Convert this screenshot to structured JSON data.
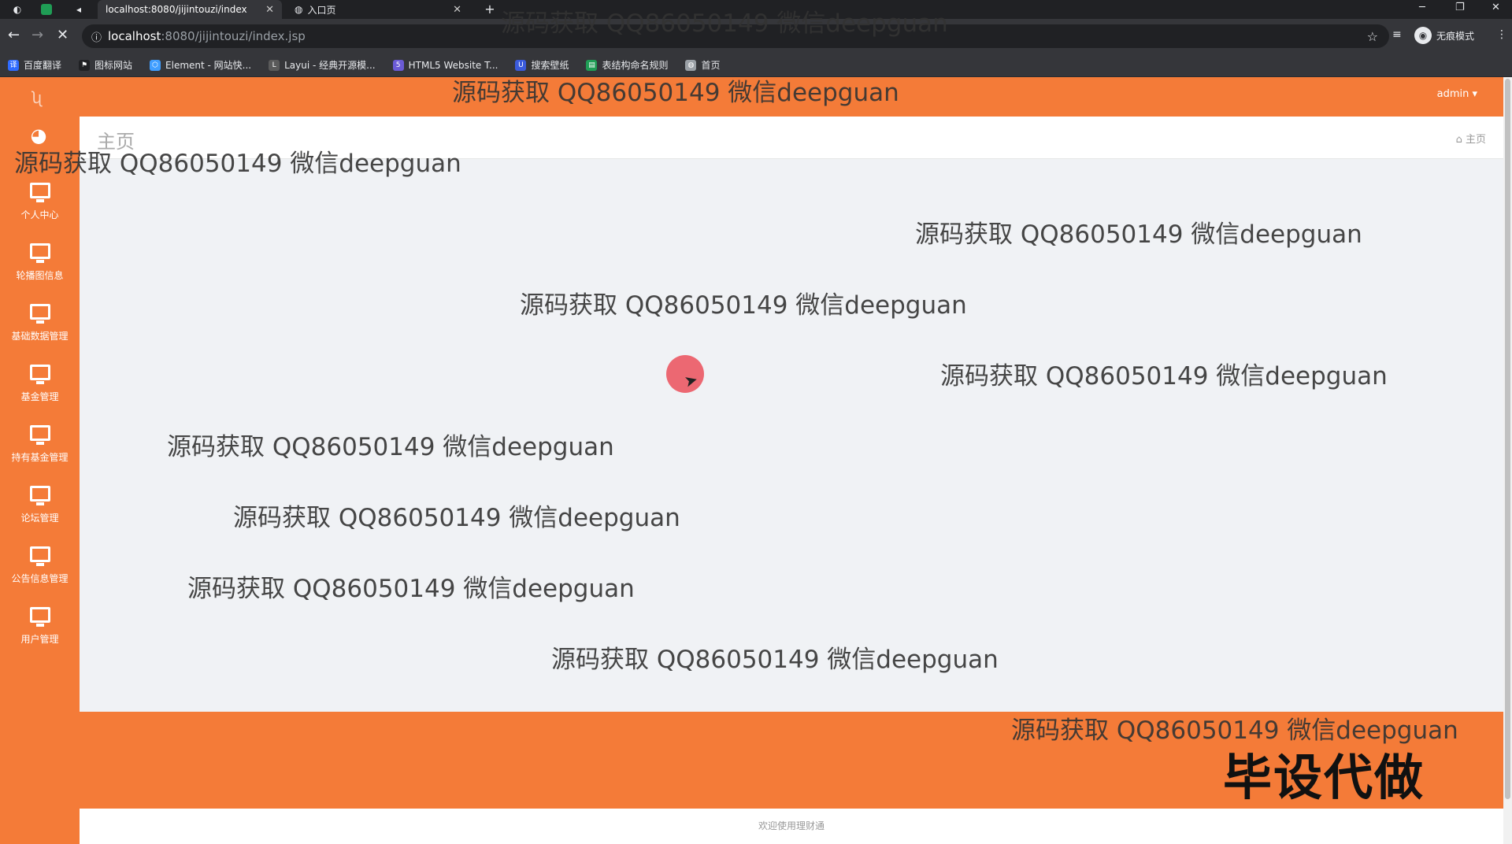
{
  "browser": {
    "tabs": [
      {
        "title": "localhost:8080/jijintouzi/index"
      },
      {
        "title": "入口页"
      }
    ],
    "address": {
      "host": "localhost",
      "path": ":8080/jijintouzi/index.jsp"
    },
    "incognito_label": "无痕模式",
    "bookmarks": [
      {
        "label": "百度翻译",
        "color": "#2f6bff"
      },
      {
        "label": "图标网站",
        "color": "#202124"
      },
      {
        "label": "Element - 网站快...",
        "color": "#409eff"
      },
      {
        "label": "Layui - 经典开源模...",
        "color": "#5a5a5a"
      },
      {
        "label": "HTML5 Website T...",
        "color": "#6b5bd6"
      },
      {
        "label": "搜索壁纸",
        "color": "#3b5bdb"
      },
      {
        "label": "表结构命名规则",
        "color": "#1f9d55"
      },
      {
        "label": "首页",
        "color": "#9aa0a6"
      }
    ]
  },
  "app": {
    "accent": "#f47b38",
    "user_menu": "admin ▾",
    "page_title": "主页",
    "breadcrumb": "主页",
    "sidebar": [
      {
        "label": "个人中心"
      },
      {
        "label": "轮播图信息"
      },
      {
        "label": "基础数据管理"
      },
      {
        "label": "基金管理"
      },
      {
        "label": "持有基金管理"
      },
      {
        "label": "论坛管理"
      },
      {
        "label": "公告信息管理"
      },
      {
        "label": "用户管理"
      }
    ],
    "footer_text": "欢迎使用理财通"
  },
  "overlay": {
    "watermark": "源码获取 QQ86050149 微信deepguan",
    "slogan": "毕设代做"
  }
}
